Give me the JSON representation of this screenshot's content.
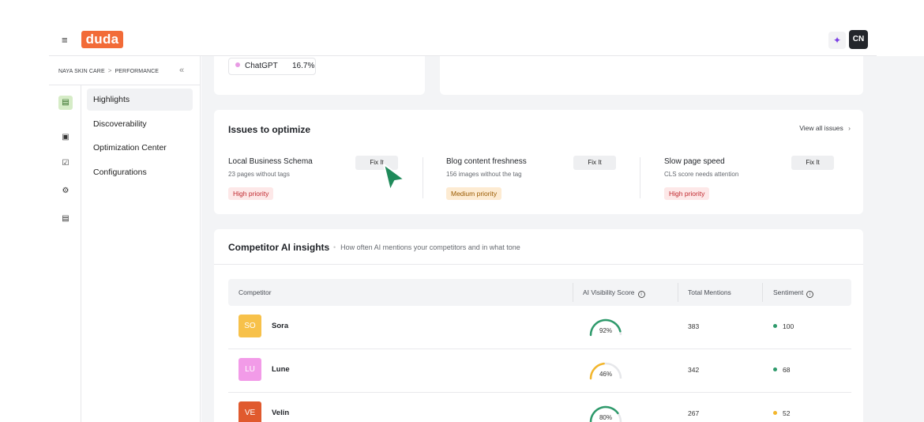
{
  "header": {
    "menu_icon": "hamburger-icon",
    "logo_text": "duda",
    "ai_icon": "sparkle-icon",
    "avatar_initials": "CN",
    "brand_color": "#f26b38"
  },
  "sidebar": {
    "breadcrumb": [
      "NAYA SKIN CARE",
      "PERFORMANCE"
    ],
    "collapse_icon": "double-chevron-left-icon",
    "rail_icons": [
      "chart-icon",
      "store-icon",
      "checklist-icon",
      "gear-icon",
      "document-icon"
    ],
    "items": [
      {
        "label": "Highlights",
        "active": true
      },
      {
        "label": "Discoverability",
        "active": false
      },
      {
        "label": "Optimization Center",
        "active": false
      },
      {
        "label": "Configurations",
        "active": false
      }
    ]
  },
  "top_card": {
    "chip_label": "ChatGPT",
    "chip_value": "16.7%"
  },
  "issues": {
    "title": "Issues to optimize",
    "view_all": "View all issues",
    "items": [
      {
        "name": "Local Business Schema",
        "desc": "23 pages without tags",
        "button": "Fix It",
        "priority": "High priority"
      },
      {
        "name": "Blog content freshness",
        "desc": "156 images without the tag",
        "button": "Fix It",
        "priority": "Medium priority"
      },
      {
        "name": "Slow page speed",
        "desc": "CLS score needs attention",
        "button": "Fix It",
        "priority": "High priority"
      }
    ]
  },
  "competitors": {
    "title": "Competitor AI insights",
    "subtitle": "How often AI mentions your competitors and in what tone",
    "columns": [
      "Competitor",
      "AI Visibility Score",
      "Total Mentions",
      "Sentiment"
    ],
    "rows": [
      {
        "initials": "SO",
        "name": "Sora",
        "score": 92,
        "score_label": "92%",
        "mentions": "383",
        "sentiment": "100",
        "avatar_color": "#f7c14a",
        "gauge_color": "#2e9a6b",
        "sentiment_color": "#2e9a6b"
      },
      {
        "initials": "LU",
        "name": "Lune",
        "score": 46,
        "score_label": "46%",
        "mentions": "342",
        "sentiment": "68",
        "avatar_color": "#f29be8",
        "gauge_color": "#f3b62c",
        "sentiment_color": "#2e9a6b"
      },
      {
        "initials": "VE",
        "name": "Velin",
        "score": 80,
        "score_label": "80%",
        "mentions": "267",
        "sentiment": "52",
        "avatar_color": "#e05a2e",
        "gauge_color": "#2e9a6b",
        "sentiment_color": "#f3b62c"
      }
    ]
  }
}
